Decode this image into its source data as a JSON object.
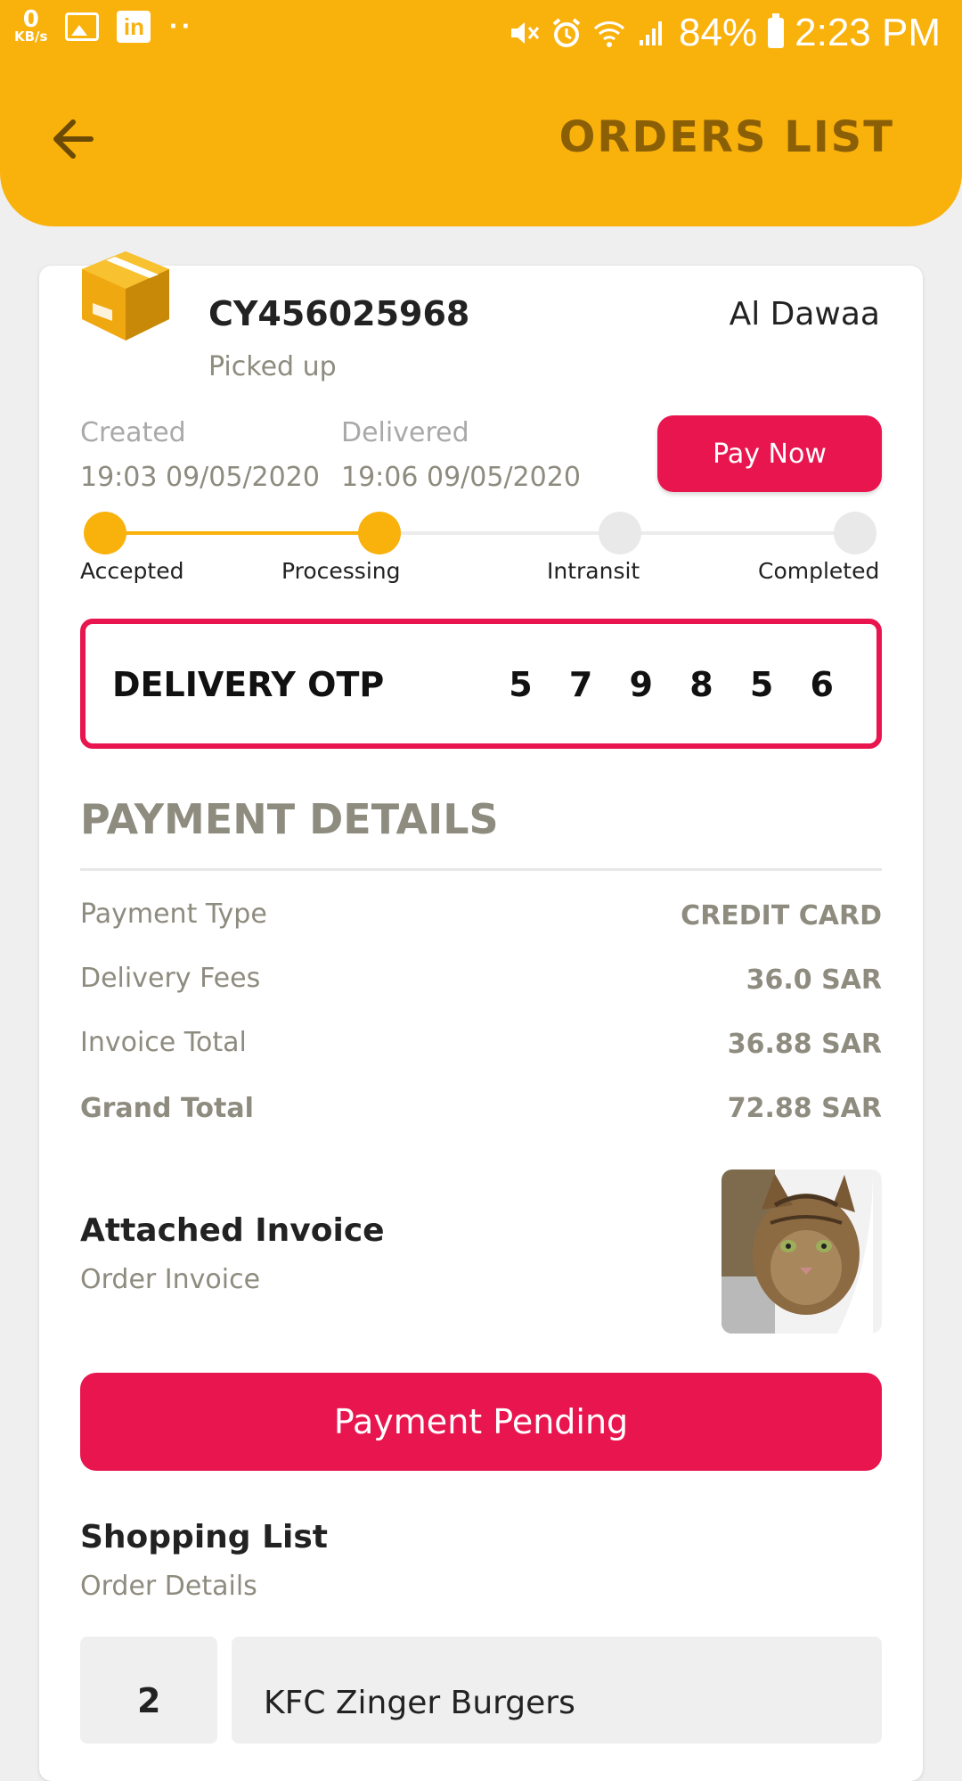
{
  "statusbar": {
    "speed_value": "0",
    "speed_unit": "KB/s",
    "dots": "··",
    "battery": "84%",
    "time": "2:23 PM"
  },
  "header": {
    "title": "ORDERS LIST"
  },
  "order": {
    "id": "CY456025968",
    "status": "Picked up",
    "store": "Al Dawaa",
    "created_label": "Created",
    "created_value": "19:03 09/05/2020",
    "delivered_label": "Delivered",
    "delivered_value": "19:06 09/05/2020",
    "pay_now": "Pay Now"
  },
  "progress": {
    "steps": [
      "Accepted",
      "Processing",
      "Intransit",
      "Completed"
    ],
    "completed_steps": 2,
    "active_color": "#f9b10c"
  },
  "otp": {
    "label": "DELIVERY OTP",
    "value": "5 7 9 8 5 6"
  },
  "payment": {
    "title": "PAYMENT DETAILS",
    "rows": [
      {
        "label": "Payment Type",
        "value": "CREDIT CARD"
      },
      {
        "label": "Delivery Fees",
        "value": "36.0 SAR"
      },
      {
        "label": "Invoice Total",
        "value": "36.88 SAR"
      },
      {
        "label": "Grand Total",
        "value": "72.88 SAR"
      }
    ]
  },
  "invoice": {
    "title": "Attached Invoice",
    "subtitle": "Order Invoice"
  },
  "pending_button": "Payment Pending",
  "shopping": {
    "title": "Shopping List",
    "subtitle": "Order Details",
    "items": [
      {
        "qty": "2",
        "name": "KFC Zinger Burgers"
      }
    ]
  },
  "colors": {
    "brand": "#f9b10c",
    "accent": "#e8154f",
    "muted": "#8e8b7f"
  }
}
